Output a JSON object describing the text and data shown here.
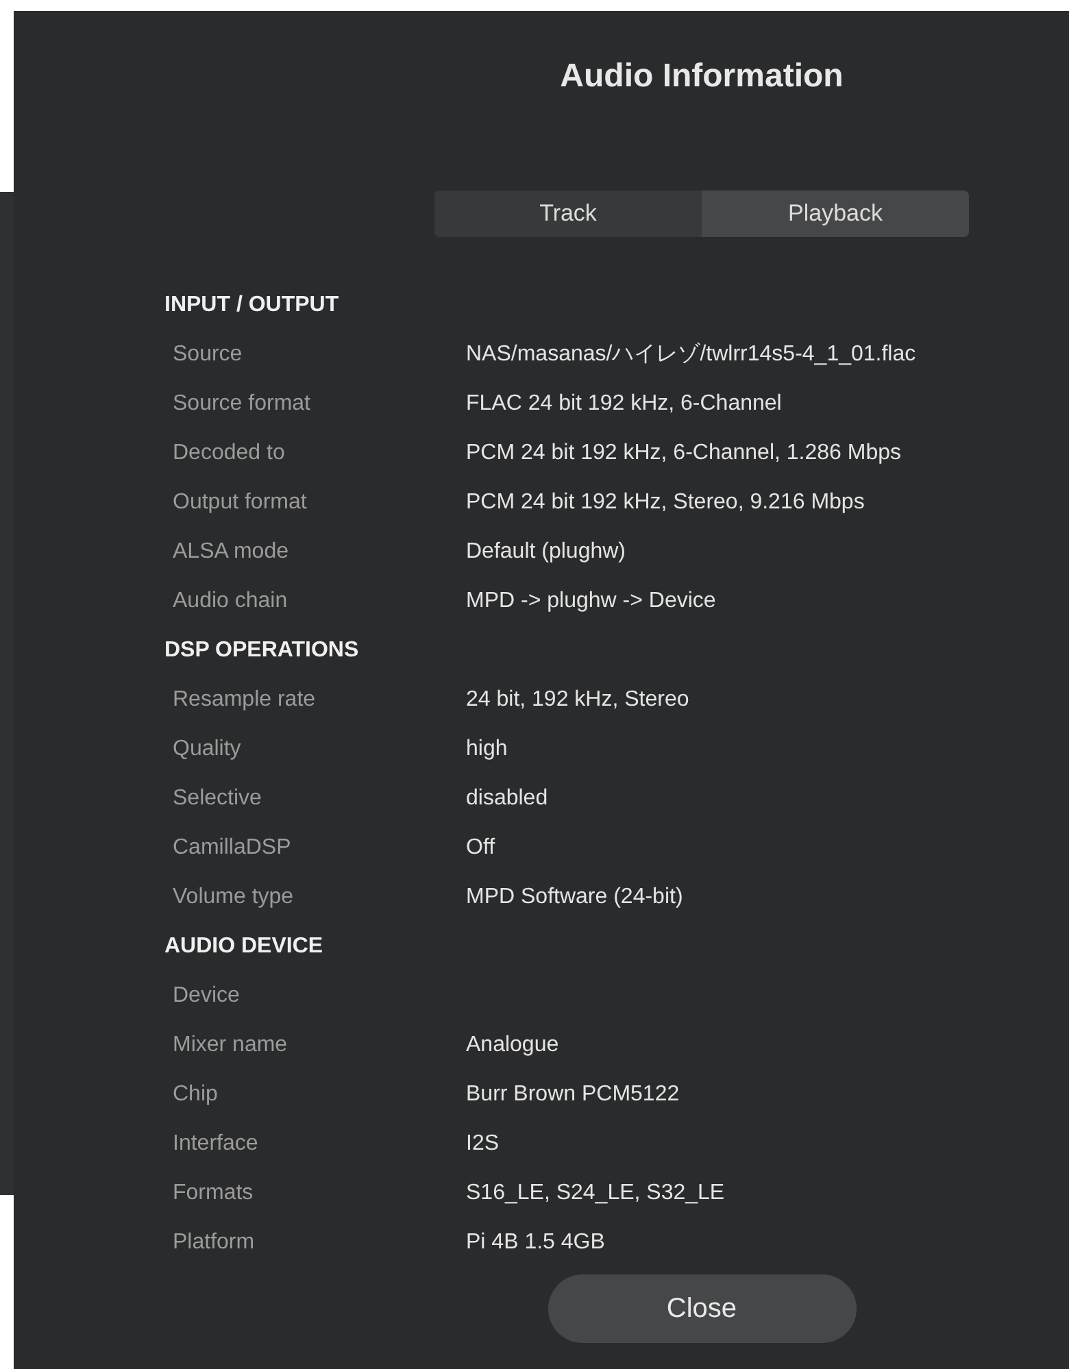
{
  "dialog": {
    "title": "Audio Information",
    "tabs": [
      {
        "label": "Track",
        "selected": false
      },
      {
        "label": "Playback",
        "selected": true
      }
    ],
    "sections": [
      {
        "heading": "INPUT / OUTPUT",
        "rows": [
          {
            "label": "Source",
            "value": "NAS/masanas/ハイレゾ/twlrr14s5-4_1_01.flac"
          },
          {
            "label": "Source format",
            "value": "FLAC 24 bit 192 kHz, 6-Channel"
          },
          {
            "label": "Decoded to",
            "value": "PCM 24 bit 192 kHz, 6-Channel, 1.286 Mbps"
          },
          {
            "label": "Output format",
            "value": "PCM 24 bit 192 kHz, Stereo, 9.216 Mbps"
          },
          {
            "label": "ALSA mode",
            "value": "Default (plughw)"
          },
          {
            "label": "Audio chain",
            "value": "MPD -> plughw -> Device"
          }
        ]
      },
      {
        "heading": "DSP OPERATIONS",
        "rows": [
          {
            "label": "Resample rate",
            "value": "24 bit, 192 kHz, Stereo"
          },
          {
            "label": "Quality",
            "value": "high"
          },
          {
            "label": "Selective",
            "value": "disabled"
          },
          {
            "label": "CamillaDSP",
            "value": "Off"
          },
          {
            "label": "Volume type",
            "value": "MPD Software (24-bit)"
          }
        ]
      },
      {
        "heading": "AUDIO DEVICE",
        "rows": [
          {
            "label": "Device"
          },
          {
            "label": "Mixer name",
            "value": "Analogue"
          },
          {
            "label": "Chip",
            "value": "Burr Brown PCM5122"
          },
          {
            "label": "Interface",
            "value": "I2S"
          },
          {
            "label": "Formats",
            "value": "S16_LE, S24_LE, S32_LE"
          },
          {
            "label": "Platform",
            "value": "Pi 4B 1.5 4GB"
          }
        ]
      }
    ],
    "close_button": "Close"
  }
}
